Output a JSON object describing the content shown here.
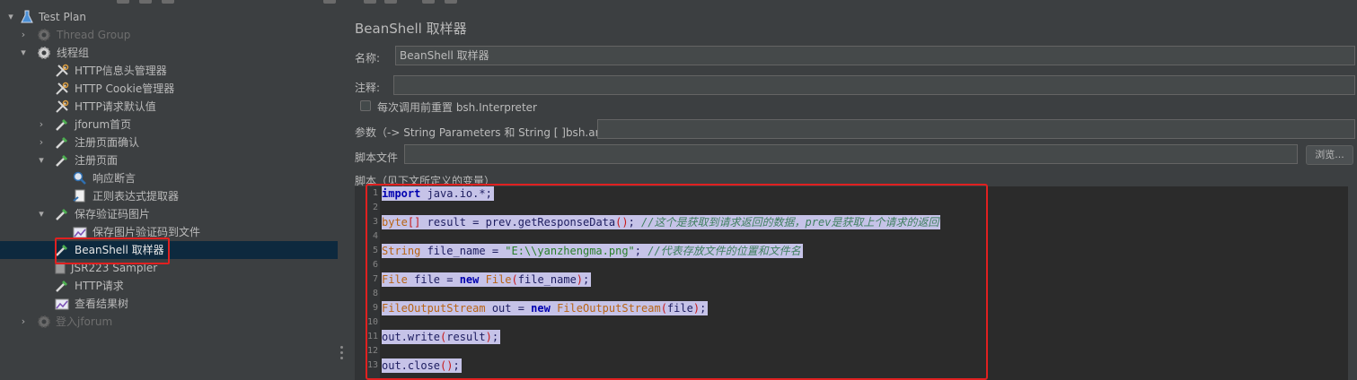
{
  "tree": {
    "items": [
      {
        "label": "Test Plan",
        "icon": "flask-icon",
        "arrow": "▾",
        "dim": false
      },
      {
        "label": "Thread Group",
        "icon": "gear-icon",
        "arrow": "›",
        "dim": true
      },
      {
        "label": "线程组",
        "icon": "gear-icon",
        "arrow": "▾",
        "dim": false
      },
      {
        "label": "HTTP信息头管理器",
        "icon": "wrench-icon",
        "arrow": "",
        "dim": false
      },
      {
        "label": "HTTP Cookie管理器",
        "icon": "wrench-icon",
        "arrow": "",
        "dim": false
      },
      {
        "label": "HTTP请求默认值",
        "icon": "wrench-icon",
        "arrow": "",
        "dim": false
      },
      {
        "label": "jforum首页",
        "icon": "pipette-icon",
        "arrow": "›",
        "dim": false
      },
      {
        "label": "注册页面确认",
        "icon": "pipette-icon",
        "arrow": "›",
        "dim": false
      },
      {
        "label": "注册页面",
        "icon": "pipette-icon",
        "arrow": "▾",
        "dim": false
      },
      {
        "label": "响应断言",
        "icon": "magnifier-icon",
        "arrow": "",
        "dim": false
      },
      {
        "label": "正则表达式提取器",
        "icon": "extractor-icon",
        "arrow": "",
        "dim": false
      },
      {
        "label": "保存验证码图片",
        "icon": "pipette-icon",
        "arrow": "▾",
        "dim": false
      },
      {
        "label": "保存图片验证码到文件",
        "icon": "chart-icon",
        "arrow": "",
        "dim": false
      },
      {
        "label": "BeanShell 取样器",
        "icon": "pipette-icon",
        "arrow": "",
        "dim": false
      },
      {
        "label": "JSR223 Sampler",
        "icon": "page-icon",
        "arrow": "",
        "dim": false
      },
      {
        "label": "HTTP请求",
        "icon": "pipette-icon",
        "arrow": "",
        "dim": false
      },
      {
        "label": "查看结果树",
        "icon": "chart-icon",
        "arrow": "",
        "dim": false
      },
      {
        "label": "登入jforum",
        "icon": "gear-icon",
        "arrow": "›",
        "dim": true
      }
    ]
  },
  "panel": {
    "title": "BeanShell 取样器",
    "name_label": "名称:",
    "name_value": "BeanShell 取样器",
    "comment_label": "注释:",
    "reset_label": "每次调用前重置 bsh.Interpreter",
    "params_label": "参数（-> String Parameters 和 String [ ]bsh.args）",
    "file_label": "脚本文件",
    "browse_label": "浏览...",
    "script_label": "脚本（见下文所定义的变量）"
  },
  "editor": {
    "line_numbers": [
      "1",
      "2",
      "3",
      "4",
      "5",
      "6",
      "7",
      "8",
      "9",
      "10",
      "11",
      "12",
      "13"
    ],
    "lines": [
      "import java.io.*;",
      "",
      "byte[] result = prev.getResponseData(); //这个是获取到请求返回的数据，prev是获取上个请求的返回",
      "",
      "String file_name = \"E:\\\\yanzhengma.png\"; //代表存放文件的位置和文件名",
      "",
      "File file = new File(file_name);",
      "",
      "FileOutputStream out = new FileOutputStream(file);",
      "",
      "out.write(result);",
      "",
      "out.close();"
    ]
  },
  "colors": {
    "background": "#3c3f41",
    "selection": "#0d293e",
    "highlight": "#c6c3e8",
    "annotation": "#e02020"
  }
}
